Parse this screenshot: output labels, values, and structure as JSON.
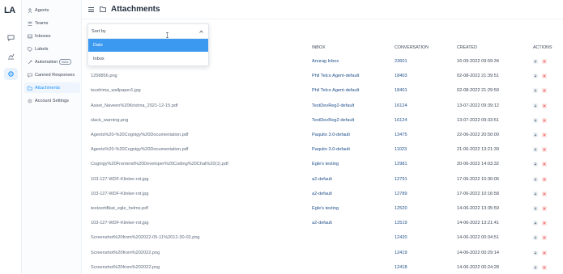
{
  "app": {
    "logo": "LA"
  },
  "header": {
    "title": "Attachments"
  },
  "sidebar": {
    "items": [
      {
        "label": "Agents",
        "badge": ""
      },
      {
        "label": "Teams",
        "badge": ""
      },
      {
        "label": "Inboxes",
        "badge": ""
      },
      {
        "label": "Labels",
        "badge": ""
      },
      {
        "label": "Automation",
        "badge": "Beta"
      },
      {
        "label": "Canned Responses",
        "badge": ""
      },
      {
        "label": "Attachments",
        "badge": ""
      },
      {
        "label": "Account Settings",
        "badge": ""
      }
    ],
    "active_index": 6
  },
  "sort": {
    "placeholder": "Sort by",
    "options": [
      "Date",
      "Inbox"
    ],
    "selected": "Date"
  },
  "table": {
    "headers": {
      "inbox": "INBOX",
      "conversation": "CONVERSATION",
      "created": "CREATED",
      "actions": "ACTIONS"
    },
    "rows": [
      {
        "name": "",
        "inbox": "Anurag Inbox",
        "conversation": "23601",
        "created": "16-09-2022 09:59:34"
      },
      {
        "name": "1258856.png",
        "inbox": "Phil Telco Agent-default",
        "conversation": "18403",
        "created": "02-08-2022 21:39:51"
      },
      {
        "name": "tsushima_wallpaper1.jpg",
        "inbox": "Phil Telco Agent-default",
        "conversation": "18401",
        "created": "02-08-2022 21:29:59"
      },
      {
        "name": "Asset_Naveen%20Krishna_2021-12-15.pdf",
        "inbox": "TestDevReg2-default",
        "conversation": "16124",
        "created": "13-07-2022 09:39:12"
      },
      {
        "name": "slack_warning.png",
        "inbox": "TestDevReg2-default",
        "conversation": "16124",
        "created": "13-07-2022 09:33:51"
      },
      {
        "name": "Agents%20-%20Cognigy%20Documentation.pdf",
        "inbox": "Paquito 3.0-default",
        "conversation": "13475",
        "created": "22-06-2022 20:50:00"
      },
      {
        "name": "Agents%20-%20Cognigy%20Documentation.pdf",
        "inbox": "Paquito 3.0-default",
        "conversation": "11023",
        "created": "21-06-2022 13:21:39"
      },
      {
        "name": "Cognigy%20Frontend%20Developer%20Coding%20Chal%20(1).pdf",
        "inbox": "Egle's testing",
        "conversation": "12981",
        "created": "20-06-2022 14:03:32"
      },
      {
        "name": "103-127-WDF-Klinker-rot.jpg",
        "inbox": "a2-default",
        "conversation": "12791",
        "created": "17-06-2022 10:30:06"
      },
      {
        "name": "103-127-WDF-Klinker-rot.jpg",
        "inbox": "a2-default",
        "conversation": "12789",
        "created": "17-06-2022 10:16:58"
      },
      {
        "name": "testzertifikat_egle_helms.pdf",
        "inbox": "Egle's testing",
        "conversation": "12520",
        "created": "14-06-2022 13:35:59"
      },
      {
        "name": "103-127-WDF-Klinker-rot.jpg",
        "inbox": "a2-default",
        "conversation": "12519",
        "created": "14-06-2022 13:21:41"
      },
      {
        "name": "Screenshot%20from%202022-05-11%2012-30-02.png",
        "inbox": "",
        "conversation": "12420",
        "created": "14-06-2022 00:34:51"
      },
      {
        "name": "Screenshot%20from%202022.png",
        "inbox": "",
        "conversation": "12419",
        "created": "14-06-2022 00:29:14"
      },
      {
        "name": "Screenshot%20from%202022.png",
        "inbox": "",
        "conversation": "12418",
        "created": "14-06-2022 00:24:28"
      }
    ]
  },
  "colors": {
    "accent": "#1f93ff",
    "link": "#1f4f8a",
    "selected": "#3c99f0",
    "delete": "#f0524f"
  }
}
